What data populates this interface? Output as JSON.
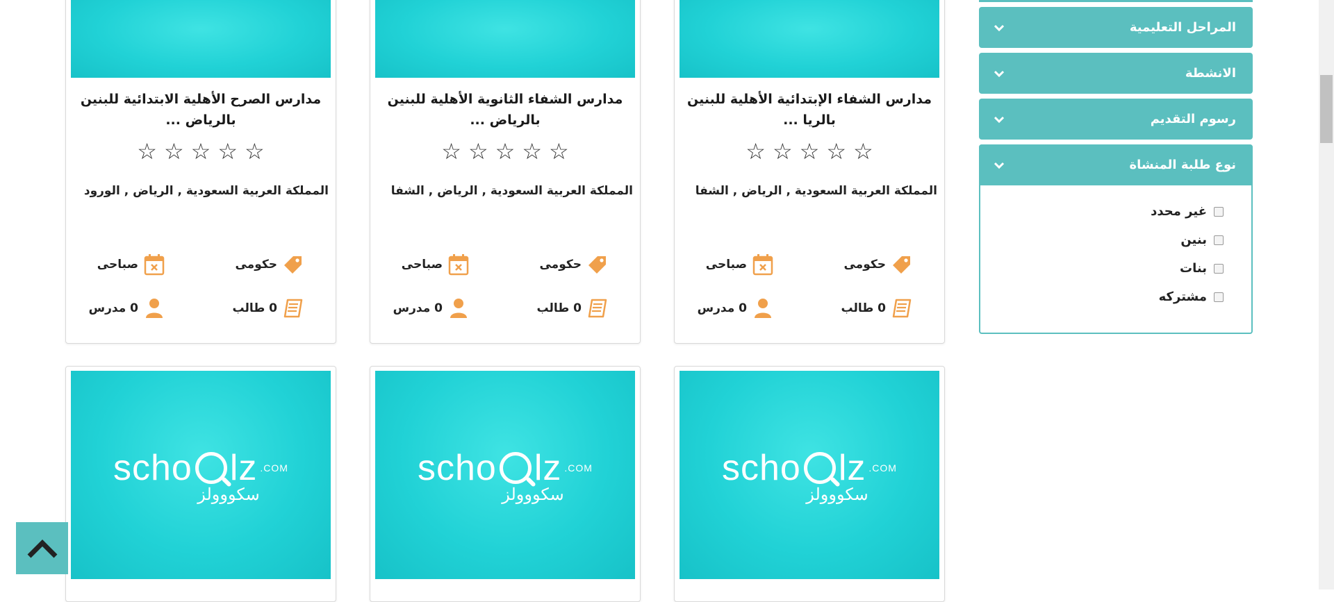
{
  "cards": [
    {
      "title": "مدارس الشفاء الإبتدائية الأهلية للبنين بالريا ...",
      "address": "المملكة العربية السعودية , الرياض , الشفا",
      "type": "حكومى",
      "period": "صباحى",
      "students": "0 طالب",
      "teachers": "0 مدرس",
      "rating": 0
    },
    {
      "title": "مدارس الشفاء الثانوية الأهلية للبنين بالرياض ...",
      "address": "المملكة العربية السعودية , الرياض , الشفا",
      "type": "حكومى",
      "period": "صباحى",
      "students": "0 طالب",
      "teachers": "0 مدرس",
      "rating": 0
    },
    {
      "title": "مدارس الصرح الأهلية الابتدائية للبنين بالرياض ...",
      "address": "المملكة العربية السعودية , الرياض , الورود",
      "type": "حكومى",
      "period": "صباحى",
      "students": "0 طالب",
      "teachers": "0 مدرس",
      "rating": 0
    }
  ],
  "brand": {
    "latin": "schoolz",
    "com": ".COM",
    "arabic": "سكووولز"
  },
  "filters": [
    {
      "label": "المراحل التعليمية"
    },
    {
      "label": "الانشطة"
    },
    {
      "label": "رسوم التقديم"
    }
  ],
  "open_filter": {
    "label": "نوع طلبة المنشاة",
    "options": [
      "غير محدد",
      "بنين",
      "بنات",
      "مشتركه"
    ]
  },
  "colors": {
    "accent": "#5bbfbf",
    "icon": "#f0a04b",
    "thumb": "#21d2d6"
  },
  "icons": {
    "tag": "tag-icon",
    "calendar": "calendar-icon",
    "book": "book-icon",
    "user": "user-icon",
    "chevron": "chevron-down-icon",
    "scroll_top": "chevron-up-icon",
    "star": "star-outline-icon"
  }
}
